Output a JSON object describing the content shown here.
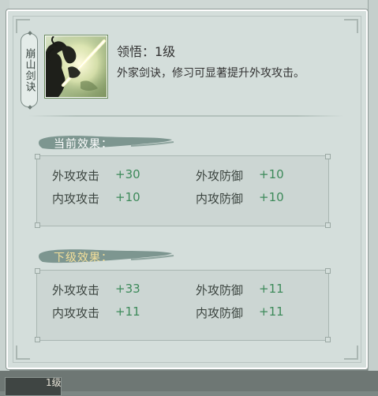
{
  "skill": {
    "name": "崩山剑诀",
    "level_text": "领悟：1级",
    "description": "外家剑诀，修习可显著提升外攻攻击。"
  },
  "current_effects": {
    "title": "当前效果：",
    "stats": [
      {
        "label": "外攻攻击",
        "value": "+30"
      },
      {
        "label": "外攻防御",
        "value": "+10"
      },
      {
        "label": "内攻攻击",
        "value": "+10"
      },
      {
        "label": "内攻防御",
        "value": "+10"
      }
    ]
  },
  "next_effects": {
    "title": "下级效果：",
    "stats": [
      {
        "label": "外攻攻击",
        "value": "+33"
      },
      {
        "label": "外攻防御",
        "value": "+11"
      },
      {
        "label": "内攻攻击",
        "value": "+11"
      },
      {
        "label": "内攻防御",
        "value": "+11"
      }
    ]
  },
  "background": {
    "slot_text": "1级"
  },
  "colors": {
    "panel_bg": "#d4dedb",
    "stat_value": "#3d8a5a",
    "current_header_text": "#ffffff",
    "next_header_text": "#f3df9a",
    "brush": "#7d9690"
  }
}
